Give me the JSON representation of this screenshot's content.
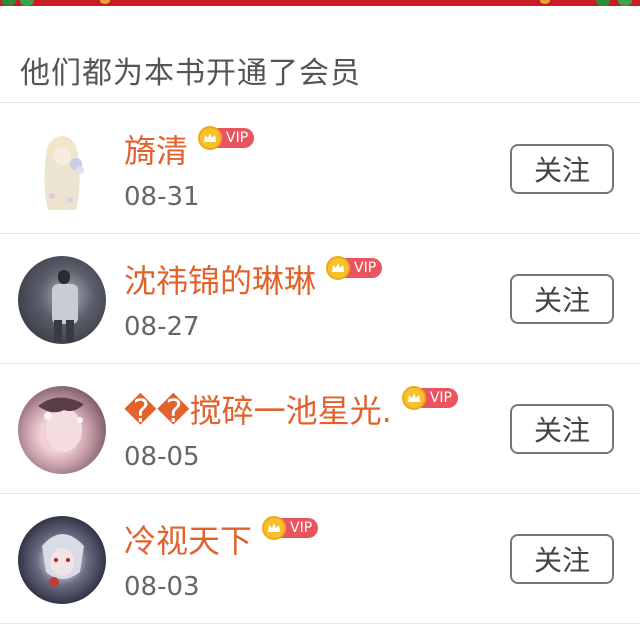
{
  "header": {
    "title": "他们都为本书开通了会员"
  },
  "vip_badge": {
    "label": "VIP",
    "icon": "crown-icon"
  },
  "follow_label": "关注",
  "members": [
    {
      "name": "旖清",
      "date": "08-31"
    },
    {
      "name": "沈祎锦的琳琳",
      "date": "08-27"
    },
    {
      "name": "��搅碎一池星光.",
      "date": "08-05"
    },
    {
      "name": "冷视天下",
      "date": "08-03"
    }
  ],
  "colors": {
    "name": "#e2622d",
    "vip_tag": "#e9545e",
    "crown": "#f6c12b",
    "banner": "#c81d25"
  }
}
